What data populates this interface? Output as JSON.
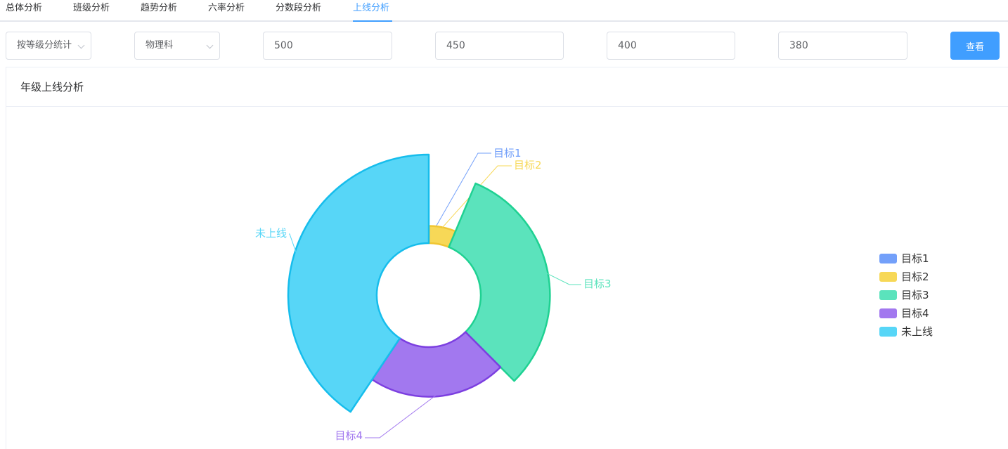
{
  "tabs": [
    {
      "label": "总体分析"
    },
    {
      "label": "班级分析"
    },
    {
      "label": "趋势分析"
    },
    {
      "label": "六率分析"
    },
    {
      "label": "分数段分析"
    },
    {
      "label": "上线分析",
      "active": true
    }
  ],
  "filters": {
    "mode_select": "按等级分统计",
    "subject_select": "物理科",
    "line_values": [
      "500",
      "450",
      "400",
      "380"
    ],
    "view_button": "查看"
  },
  "card": {
    "title": "年级上线分析"
  },
  "chart_data": {
    "type": "pie",
    "variant": "rose-donut",
    "legend_position": "right",
    "slices": [
      {
        "name": "目标1",
        "value": 0.2,
        "color": "#73a0fa",
        "border": "#5b8ff0"
      },
      {
        "name": "目标2",
        "value": 20,
        "color": "#f7d857",
        "border": "#f0c633"
      },
      {
        "name": "目标3",
        "value": 100,
        "color": "#5be3bc",
        "border": "#1fd192"
      },
      {
        "name": "目标4",
        "value": 70,
        "color": "#a278ef",
        "border": "#7c3fe0"
      },
      {
        "name": "未上线",
        "value": 130,
        "color": "#57d6f7",
        "border": "#16bdec"
      }
    ]
  }
}
